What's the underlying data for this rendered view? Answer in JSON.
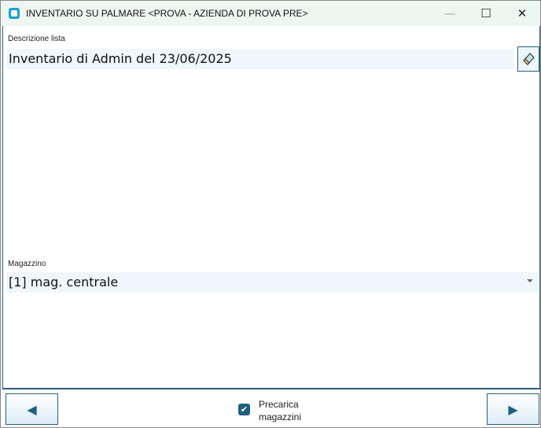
{
  "window": {
    "title": "INVENTARIO SU PALMARE <PROVA - AZIENDA DI PROVA PRE>",
    "minimize": "—",
    "maximize": "☐",
    "close": "✕"
  },
  "form": {
    "description_label": "Descrizione lista",
    "description_value": "Inventario di Admin del 23/06/2025",
    "warehouse_label": "Magazzino",
    "warehouse_value": "[1] mag. centrale"
  },
  "footer": {
    "preload_label": "Precarica magazzini",
    "preload_checked": true,
    "prev": "◀",
    "next": "▶"
  },
  "colors": {
    "accent": "#1f5f82"
  }
}
